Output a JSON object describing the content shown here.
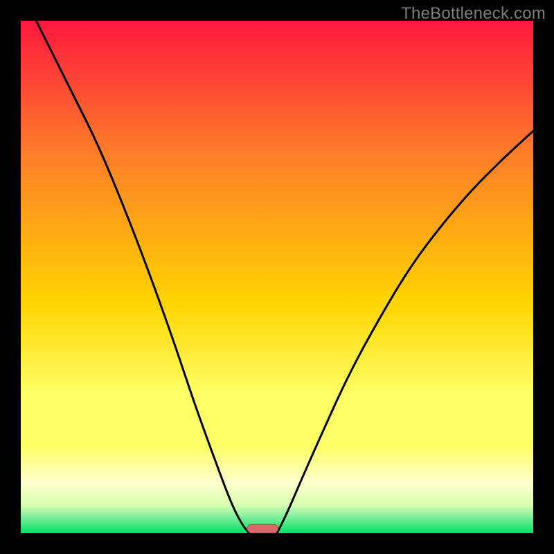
{
  "watermark": "TheBottleneck.com",
  "colors": {
    "gradient_top": "#ff173e",
    "gradient_mid1": "#ff7a2a",
    "gradient_mid2": "#ffd400",
    "gradient_low": "#ffff66",
    "gradient_pale": "#ffffcc",
    "gradient_green": "#00e262",
    "curve": "#000000",
    "marker_fill": "#da6a6a",
    "marker_stroke": "#c24e4e",
    "frame": "#000000"
  },
  "chart_data": {
    "type": "line",
    "title": "",
    "xlabel": "",
    "ylabel": "",
    "xlim": [
      0,
      1
    ],
    "ylim": [
      0,
      1
    ],
    "series": [
      {
        "name": "left-curve",
        "x": [
          0.03,
          0.06,
          0.1,
          0.15,
          0.2,
          0.25,
          0.3,
          0.34,
          0.38,
          0.41,
          0.43,
          0.445
        ],
        "y": [
          1.0,
          0.94,
          0.86,
          0.76,
          0.64,
          0.51,
          0.37,
          0.25,
          0.14,
          0.06,
          0.02,
          0.0
        ]
      },
      {
        "name": "right-curve",
        "x": [
          0.5,
          0.52,
          0.55,
          0.59,
          0.64,
          0.7,
          0.76,
          0.82,
          0.88,
          0.94,
          1.0
        ],
        "y": [
          0.0,
          0.04,
          0.11,
          0.2,
          0.31,
          0.42,
          0.52,
          0.6,
          0.67,
          0.73,
          0.785
        ]
      }
    ],
    "marker": {
      "x_center": 0.472,
      "width": 0.06,
      "height": 0.016
    }
  }
}
